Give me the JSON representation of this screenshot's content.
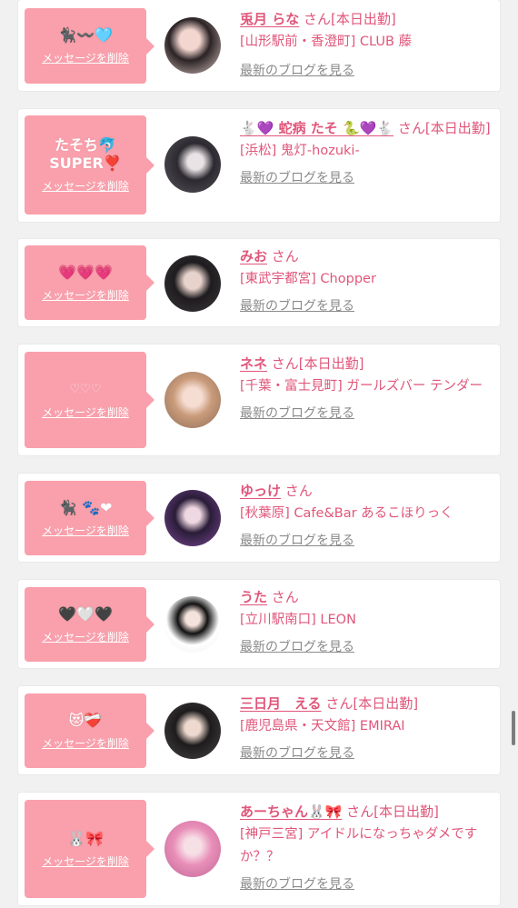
{
  "common": {
    "delete_label": "メッセージを削除",
    "blog_label": "最新のブログを見る",
    "accent_color": "#f9a0ac",
    "link_color": "#e0567a"
  },
  "cards": [
    {
      "message": "🐈‍⬛〰️🩵",
      "name": "兎月 らな",
      "honorific": "さん[本日出勤]",
      "shop": "[山形駅前・香澄町] CLUB 藤"
    },
    {
      "message": "たそち🐬\nSUPER❣️",
      "name": "🐇💜 蛇病 たそ 🐍💜🐇",
      "honorific": "さん[本日出勤]",
      "shop": "[浜松] 鬼灯-hozuki-"
    },
    {
      "message": "💗💗💗",
      "name": "みお",
      "honorific": "さん",
      "shop": "[東武宇都宮] Chopper"
    },
    {
      "message": "♡♡♡",
      "name": "ネネ",
      "honorific": "さん[本日出勤]",
      "shop": "[千葉・富士見町] ガールズバー テンダー"
    },
    {
      "message": "🐈‍⬛ 🐾❤",
      "name": "ゆっけ",
      "honorific": "さん",
      "shop": "[秋葉原] Cafe&Bar あるこほりっく"
    },
    {
      "message": "🖤🤍🖤",
      "name": "うた",
      "honorific": "さん",
      "shop": "[立川駅南口] LEON"
    },
    {
      "message": "😻❤️‍🩹",
      "name": "三日月　える",
      "honorific": "さん[本日出勤]",
      "shop": "[鹿児島県・天文館] EMIRAI"
    },
    {
      "message": "🐰🎀",
      "name": "あーちゃん🐰🎀",
      "honorific": "さん[本日出勤]",
      "shop": "[神戸三宮] アイドルになっちゃダメですか？？"
    }
  ]
}
